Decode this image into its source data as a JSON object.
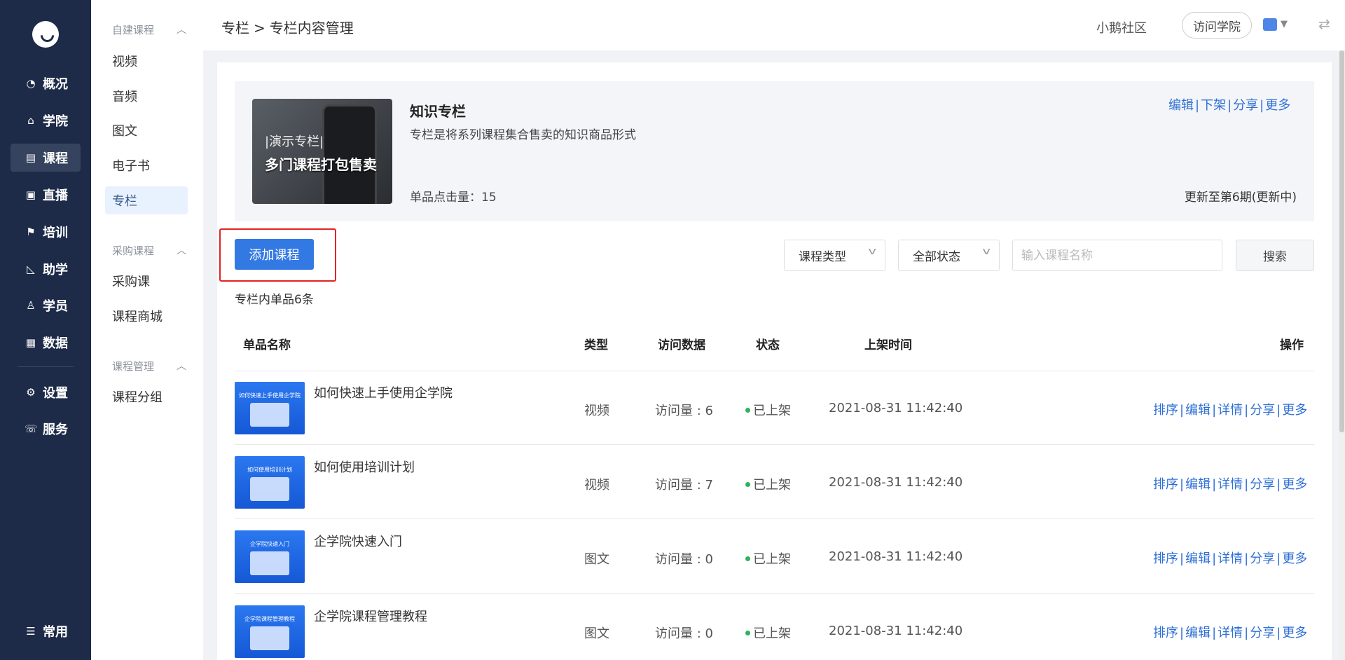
{
  "nav": {
    "items": [
      {
        "label": "概况",
        "icon": "pie-chart-icon"
      },
      {
        "label": "学院",
        "icon": "academy-icon"
      },
      {
        "label": "课程",
        "icon": "course-icon"
      },
      {
        "label": "直播",
        "icon": "live-icon"
      },
      {
        "label": "培训",
        "icon": "training-icon"
      },
      {
        "label": "助学",
        "icon": "assist-icon"
      },
      {
        "label": "学员",
        "icon": "student-icon"
      },
      {
        "label": "数据",
        "icon": "data-icon"
      },
      {
        "label": "设置",
        "icon": "gear-icon"
      },
      {
        "label": "服务",
        "icon": "service-icon"
      },
      {
        "label": "常用",
        "icon": "menu-list-icon"
      }
    ],
    "active": "课程"
  },
  "subnav": {
    "groups": [
      {
        "title": "自建课程",
        "items": [
          "视频",
          "音频",
          "图文",
          "电子书",
          "专栏"
        ]
      },
      {
        "title": "采购课程",
        "items": [
          "采购课",
          "课程商城"
        ]
      },
      {
        "title": "课程管理",
        "items": [
          "课程分组"
        ]
      }
    ],
    "active": "专栏"
  },
  "header": {
    "breadcrumb": [
      "专栏",
      ">",
      "专栏内容管理"
    ],
    "community": "小鹅社区",
    "visit_button": "访问学院"
  },
  "column": {
    "cover_text_1": "|演示专栏|",
    "cover_text_2": "多门课程打包售卖",
    "title": "知识专栏",
    "description": "专栏是将系列课程集合售卖的知识商品形式",
    "click_count": "单品点击量：15",
    "update_status": "更新至第6期(更新中)",
    "actions": [
      "编辑",
      "下架",
      "分享",
      "更多"
    ]
  },
  "toolbar": {
    "add_button": "添加课程",
    "type_select": "课程类型",
    "status_select": "全部状态",
    "search_placeholder": "输入课程名称",
    "search_button": "搜索"
  },
  "count_text": "专栏内单品6条",
  "table": {
    "headers": [
      "单品名称",
      "类型",
      "访问数据",
      "状态",
      "上架时间",
      "操作"
    ],
    "rows": [
      {
        "name": "如何快速上手使用企学院",
        "type": "视频",
        "visits": "访问量 : 6",
        "status": "已上架",
        "time": "2021-08-31 11:42:40",
        "thumb_title": "如何快速上手使用企学院"
      },
      {
        "name": "如何使用培训计划",
        "type": "视频",
        "visits": "访问量 : 7",
        "status": "已上架",
        "time": "2021-08-31 11:42:40",
        "thumb_title": "如何使用培训计划"
      },
      {
        "name": "企学院快速入门",
        "type": "图文",
        "visits": "访问量 : 0",
        "status": "已上架",
        "time": "2021-08-31 11:42:40",
        "thumb_title": "企学院快速入门"
      },
      {
        "name": "企学院课程管理教程",
        "type": "图文",
        "visits": "访问量 : 0",
        "status": "已上架",
        "time": "2021-08-31 11:42:40",
        "thumb_title": "企学院课程管理教程"
      }
    ],
    "row_actions": [
      "排序",
      "编辑",
      "详情",
      "分享",
      "更多"
    ]
  },
  "colors": {
    "sidebar_bg": "#1d2b49",
    "primary": "#3379e3",
    "link": "#2e6fd6",
    "status_green": "#2fb35b",
    "highlight_red": "#e52222"
  }
}
